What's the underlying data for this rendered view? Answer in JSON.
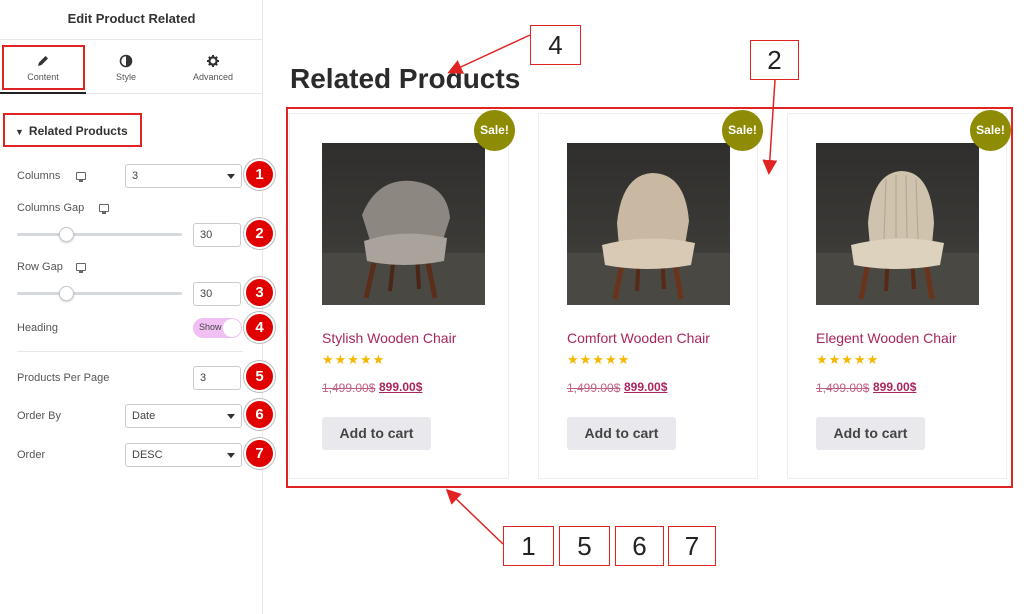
{
  "sidebar": {
    "title": "Edit Product Related",
    "tabs": [
      {
        "label": "Content",
        "icon": "pencil-icon"
      },
      {
        "label": "Style",
        "icon": "contrast-icon"
      },
      {
        "label": "Advanced",
        "icon": "gear-icon"
      }
    ],
    "section": "Related Products",
    "controls": {
      "columns": {
        "label": "Columns",
        "value": "3"
      },
      "columns_gap": {
        "label": "Columns Gap",
        "value": "30",
        "slider_fraction": 0.3
      },
      "row_gap": {
        "label": "Row Gap",
        "value": "30",
        "slider_fraction": 0.3
      },
      "heading": {
        "label": "Heading",
        "toggle_text": "Show",
        "on": true
      },
      "products_per_page": {
        "label": "Products Per Page",
        "value": "3"
      },
      "order_by": {
        "label": "Order By",
        "value": "Date"
      },
      "order": {
        "label": "Order",
        "value": "DESC"
      }
    },
    "badges": [
      "1",
      "2",
      "3",
      "4",
      "5",
      "6",
      "7"
    ]
  },
  "preview": {
    "heading": "Related Products",
    "products": [
      {
        "title": "Stylish Wooden Chair",
        "stars": "★★★★★",
        "old_price": "1,499.00$",
        "new_price": "899.00$",
        "button": "Add to cart",
        "sale": "Sale!"
      },
      {
        "title": "Comfort Wooden Chair",
        "stars": "★★★★★",
        "old_price": "1,499.00$",
        "new_price": "899.00$",
        "button": "Add to cart",
        "sale": "Sale!"
      },
      {
        "title": "Elegent Wooden Chair",
        "stars": "★★★★★",
        "old_price": "1,499.00$",
        "new_price": "899.00$",
        "button": "Add to cart",
        "sale": "Sale!"
      }
    ]
  },
  "callouts": {
    "top_heading": "4",
    "top_grid": "2",
    "bottom": [
      "1",
      "5",
      "6",
      "7"
    ]
  },
  "colors": {
    "accent_red": "#e02424",
    "badge_red": "#e00000",
    "sale_olive": "#8e8b04",
    "title_magenta": "#a8255e",
    "toggle_pink": "#f1c0f2",
    "star_gold": "#f5b700"
  }
}
